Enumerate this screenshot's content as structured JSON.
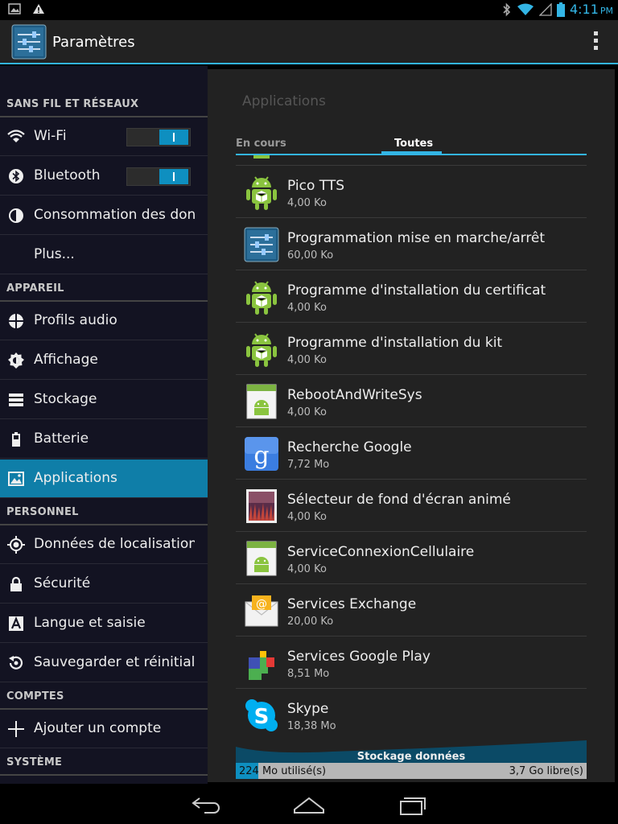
{
  "status_bar": {
    "time": "4:11",
    "ampm": "PM"
  },
  "action_bar": {
    "title": "Paramètres"
  },
  "sidebar": {
    "sections": [
      {
        "title": "SANS FIL ET RÉSEAUX"
      },
      {
        "title": "APPAREIL"
      },
      {
        "title": "PERSONNEL"
      },
      {
        "title": "COMPTES"
      },
      {
        "title": "SYSTÈME"
      }
    ],
    "items": [
      {
        "label": "Wi-Fi",
        "icon": "wifi-icon",
        "toggle": "I"
      },
      {
        "label": "Bluetooth",
        "icon": "bluetooth-icon",
        "toggle": "I"
      },
      {
        "label": "Consommation des données",
        "icon": "data-usage-icon"
      },
      {
        "label": "Plus..."
      },
      {
        "label": "Profils audio",
        "icon": "audio-profile-icon"
      },
      {
        "label": "Affichage",
        "icon": "display-icon"
      },
      {
        "label": "Stockage",
        "icon": "storage-icon"
      },
      {
        "label": "Batterie",
        "icon": "battery-icon"
      },
      {
        "label": "Applications",
        "icon": "applications-icon",
        "selected": true
      },
      {
        "label": "Données de localisation",
        "icon": "location-icon"
      },
      {
        "label": "Sécurité",
        "icon": "lock-icon"
      },
      {
        "label": "Langue et saisie",
        "icon": "language-icon"
      },
      {
        "label": "Sauvegarder et réinitialiser",
        "icon": "backup-icon"
      },
      {
        "label": "Ajouter un compte",
        "icon": "add-icon"
      }
    ]
  },
  "main": {
    "title": "Applications",
    "tabs": [
      {
        "label": "En cours"
      },
      {
        "label": "Toutes",
        "selected": true
      }
    ],
    "apps": [
      {
        "name": "Pico TTS",
        "size": "4,00 Ko",
        "icon": "android-icon"
      },
      {
        "name": "Programmation mise en marche/arrêt",
        "size": "60,00 Ko",
        "icon": "settings-sliders-icon"
      },
      {
        "name": "Programme d'installation du certificat",
        "size": "4,00 Ko",
        "icon": "android-icon"
      },
      {
        "name": "Programme d'installation du kit",
        "size": "4,00 Ko",
        "icon": "android-icon"
      },
      {
        "name": "RebootAndWriteSys",
        "size": "4,00 Ko",
        "icon": "android-app-icon"
      },
      {
        "name": "Recherche Google",
        "size": "7,72 Mo",
        "icon": "google-search-icon"
      },
      {
        "name": "Sélecteur de fond d'écran animé",
        "size": "4,00 Ko",
        "icon": "wallpaper-icon"
      },
      {
        "name": "ServiceConnexionCellulaire",
        "size": "4,00 Ko",
        "icon": "android-app-icon"
      },
      {
        "name": "Services Exchange",
        "size": "20,00 Ko",
        "icon": "exchange-mail-icon"
      },
      {
        "name": "Services Google Play",
        "size": "8,51 Mo",
        "icon": "google-play-services-icon"
      },
      {
        "name": "Skype",
        "size": "18,38 Mo",
        "icon": "skype-icon"
      }
    ],
    "storage": {
      "title": "Stockage données",
      "used": "224 Mo utilisé(s)",
      "free": "3,7 Go libre(s)",
      "used_fraction": 0.064
    }
  },
  "colors": {
    "accent": "#33b5e5",
    "selected": "#0f7ea8"
  }
}
